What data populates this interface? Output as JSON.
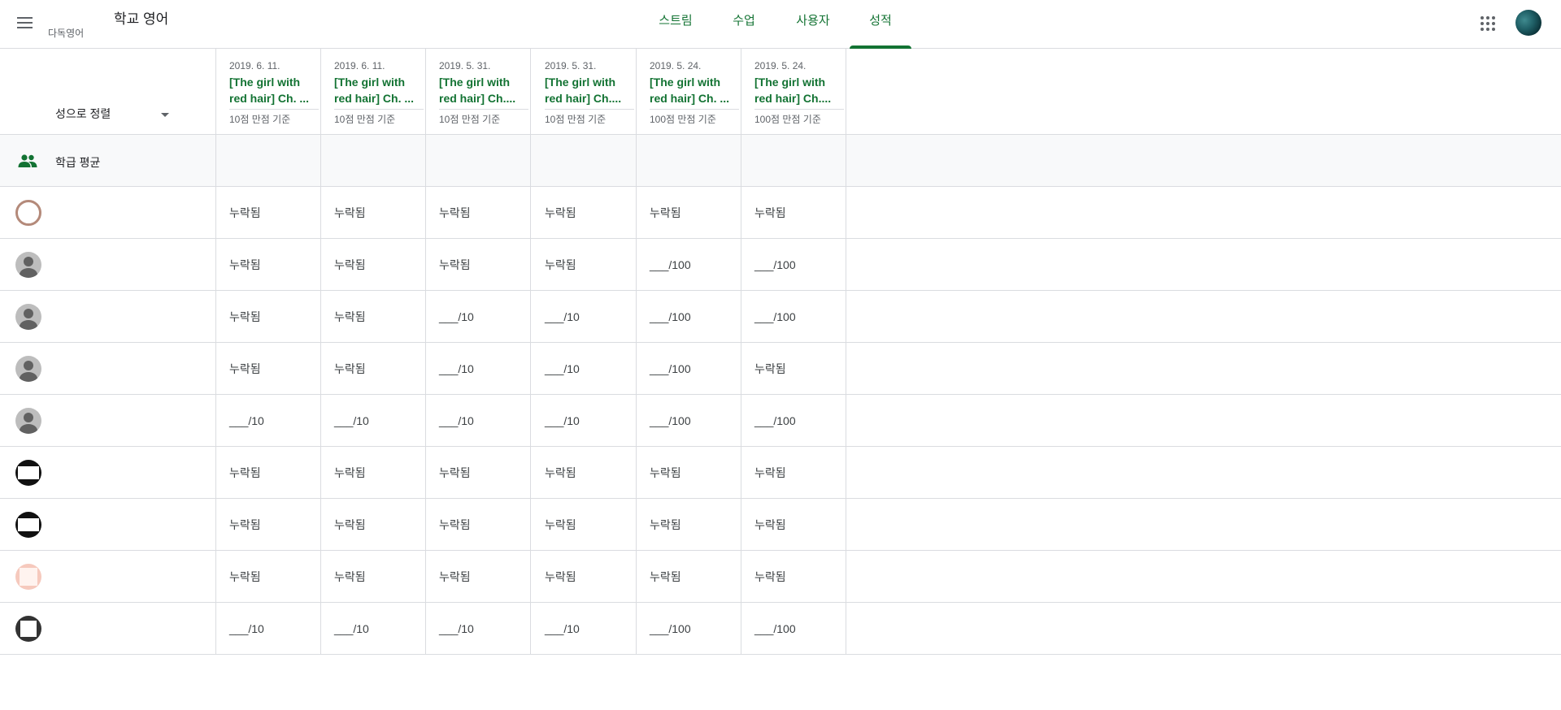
{
  "header": {
    "class_title": "학교 영어",
    "class_subtitle": "다독영어",
    "tabs": [
      "스트림",
      "수업",
      "사용자",
      "성적"
    ],
    "active_tab": "성적"
  },
  "grid": {
    "sort_label": "성으로 정렬",
    "average_label": "학급 평균",
    "columns": [
      {
        "date": "2019. 6. 11.",
        "title": "[The girl with red hair] Ch. ...",
        "points": "10점 만점 기준"
      },
      {
        "date": "2019. 6. 11.",
        "title": "[The girl with red hair] Ch. ...",
        "points": "10점 만점 기준"
      },
      {
        "date": "2019. 5. 31.",
        "title": "[The girl with red hair] Ch....",
        "points": "10점 만점 기준"
      },
      {
        "date": "2019. 5. 31.",
        "title": "[The girl with red hair] Ch....",
        "points": "10점 만점 기준"
      },
      {
        "date": "2019. 5. 24.",
        "title": "[The girl with red hair] Ch. ...",
        "points": "100점 만점 기준"
      },
      {
        "date": "2019. 5. 24.",
        "title": "[The girl with red hair] Ch....",
        "points": "100점 만점 기준"
      }
    ],
    "rows": [
      {
        "avatar": "photo-avatar",
        "cells": [
          "누락됨",
          "누락됨",
          "누락됨",
          "누락됨",
          "누락됨",
          "누락됨"
        ]
      },
      {
        "avatar": "default-avatar",
        "cells": [
          "누락됨",
          "누락됨",
          "누락됨",
          "누락됨",
          "___/100",
          "___/100"
        ]
      },
      {
        "avatar": "default-avatar",
        "cells": [
          "누락됨",
          "누락됨",
          "___/10",
          "___/10",
          "___/100",
          "___/100"
        ]
      },
      {
        "avatar": "default-avatar",
        "cells": [
          "누락됨",
          "누락됨",
          "___/10",
          "___/10",
          "___/100",
          "누락됨"
        ]
      },
      {
        "avatar": "default-avatar",
        "cells": [
          "___/10",
          "___/10",
          "___/10",
          "___/10",
          "___/100",
          "___/100"
        ]
      },
      {
        "avatar": "dark-photo-avatar",
        "cells": [
          "누락됨",
          "누락됨",
          "누락됨",
          "누락됨",
          "누락됨",
          "누락됨"
        ]
      },
      {
        "avatar": "dark-photo-avatar",
        "cells": [
          "누락됨",
          "누락됨",
          "누락됨",
          "누락됨",
          "누락됨",
          "누락됨"
        ]
      },
      {
        "avatar": "pink-photo-avatar",
        "cells": [
          "누락됨",
          "누락됨",
          "누락됨",
          "누락됨",
          "누락됨",
          "누락됨"
        ]
      },
      {
        "avatar": "pattern-photo-avatar",
        "cells": [
          "___/10",
          "___/10",
          "___/10",
          "___/10",
          "___/100",
          "___/100"
        ]
      }
    ]
  },
  "colors": {
    "accent": "#137333",
    "border": "#dadce0",
    "band": "#f8f9fa"
  }
}
